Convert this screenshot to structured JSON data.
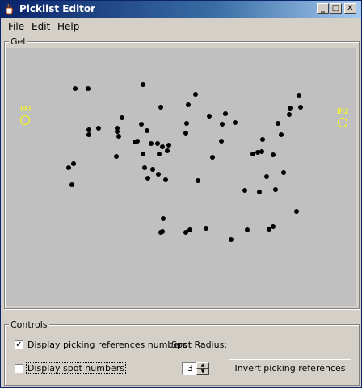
{
  "window": {
    "title": "Picklist Editor"
  },
  "title_buttons": {
    "minimize": "_",
    "maximize": "□",
    "close": "✕"
  },
  "menu": {
    "items": [
      {
        "label": "File",
        "underline": "F",
        "rest": "ile"
      },
      {
        "label": "Edit",
        "underline": "E",
        "rest": "dit"
      },
      {
        "label": "Help",
        "underline": "H",
        "rest": "elp"
      }
    ]
  },
  "gel": {
    "label": "Gel",
    "references": [
      {
        "name": "IR1"
      },
      {
        "name": "IR2"
      }
    ]
  },
  "controls": {
    "label": "Controls",
    "display_picking_refs": {
      "label": "Display picking references numbers",
      "checked": true
    },
    "spot_radius_label": "Spot Radius:",
    "display_spot_numbers": {
      "label": "Display spot numbers",
      "checked": false
    },
    "spot_radius_value": "3",
    "invert_button": "Invert picking references"
  },
  "colors": {
    "title_start": "#0a246a",
    "title_end": "#a6caf0",
    "gel_bg": "#c0c0c0",
    "reference": "#ffff00",
    "spot": "#000000"
  }
}
